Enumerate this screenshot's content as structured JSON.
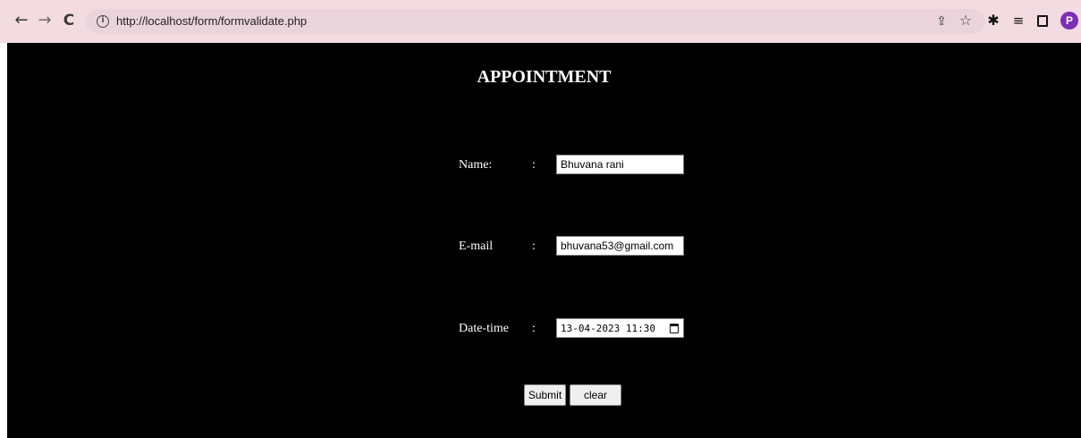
{
  "browser": {
    "url": "http://localhost/form/formvalidate.php",
    "icons": [
      "back-arrow-icon",
      "forward-arrow-icon",
      "reload-icon",
      "info-icon",
      "share-icon",
      "star-icon",
      "extensions-icon",
      "reading-list-icon",
      "side-panel-icon"
    ],
    "avatar_letter": "P",
    "avatar_color": "#7b2fb5",
    "toolbar_color": "#f3dbe2"
  },
  "form": {
    "title": "APPOINTMENT",
    "fields": [
      {
        "label": "Name:",
        "colon": ":",
        "value": "Bhuvana rani"
      },
      {
        "label": "E-mail",
        "colon": ":",
        "value": "bhuvana53@gmail.com"
      },
      {
        "label": "Date-time",
        "colon": ":",
        "value": "13-04-2023 11:30"
      }
    ],
    "submit_label": "Submit",
    "clear_label": "clear",
    "background": "#000000",
    "text_color": "#ffffff"
  }
}
